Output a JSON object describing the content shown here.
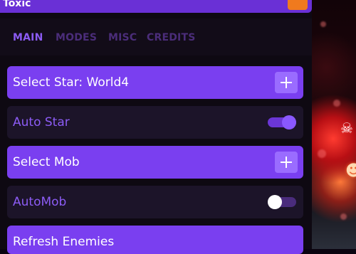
{
  "window": {
    "title": "Toxic"
  },
  "tabs": [
    {
      "label": "MAIN",
      "active": true
    },
    {
      "label": "MODES",
      "active": false
    },
    {
      "label": "MISC",
      "active": false
    },
    {
      "label": "CREDITS",
      "active": false
    }
  ],
  "rows": [
    {
      "label": "Select Star: World4",
      "type": "dropdown",
      "icon": "plus-icon"
    },
    {
      "label": "Auto Star",
      "type": "toggle",
      "state": "on"
    },
    {
      "label": "Select Mob",
      "type": "dropdown",
      "icon": "plus-icon"
    },
    {
      "label": "AutoMob",
      "type": "toggle",
      "state": "off"
    },
    {
      "label": "Refresh Enemies",
      "type": "button"
    }
  ],
  "colors": {
    "accent": "#7a3ff0",
    "panel_bg": "#0e0912",
    "secondary_row": "#1c1429",
    "tab_active": "#8b5bf2",
    "tab_inactive": "#4b2d7a",
    "close_button": "#f07a1e"
  }
}
